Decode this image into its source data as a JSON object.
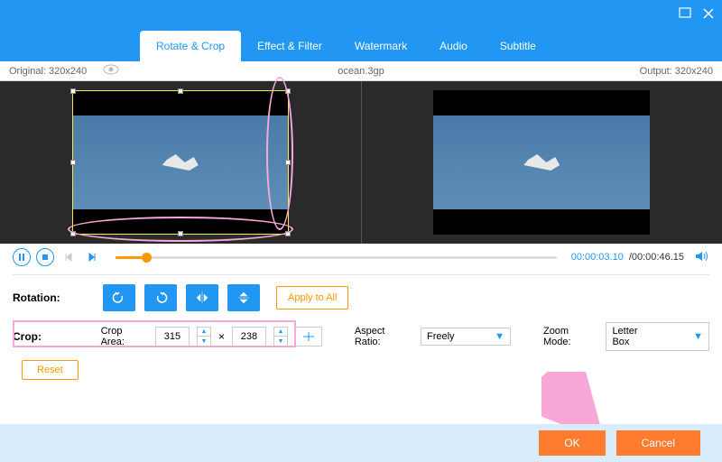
{
  "titlebar": {
    "minimize": "−",
    "close": "×"
  },
  "tabs": [
    {
      "label": "Rotate & Crop",
      "active": true
    },
    {
      "label": "Effect & Filter",
      "active": false
    },
    {
      "label": "Watermark",
      "active": false
    },
    {
      "label": "Audio",
      "active": false
    },
    {
      "label": "Subtitle",
      "active": false
    }
  ],
  "infobar": {
    "original_label": "Original: 320x240",
    "filename": "ocean.3gp",
    "output_label": "Output: 320x240"
  },
  "playback": {
    "current_time": "00:00:03.10",
    "total_time": "/00:00:46.15"
  },
  "rotation": {
    "label": "Rotation:",
    "apply_label": "Apply to All"
  },
  "crop": {
    "label": "Crop:",
    "area_label": "Crop Area:",
    "width": "315",
    "height": "238",
    "multiply": "×",
    "aspect_label": "Aspect Ratio:",
    "aspect_value": "Freely",
    "zoom_label": "Zoom Mode:",
    "zoom_value": "Letter Box",
    "reset_label": "Reset"
  },
  "actions": {
    "ok": "OK",
    "cancel": "Cancel"
  }
}
